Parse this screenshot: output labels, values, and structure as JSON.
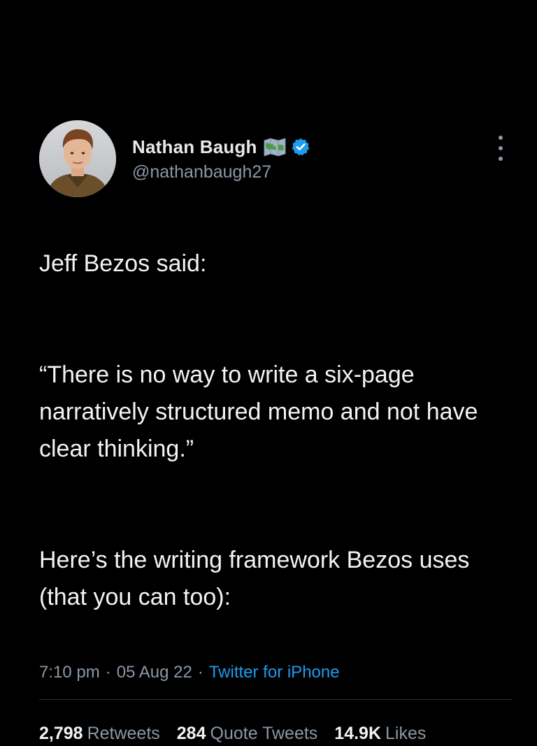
{
  "author": {
    "display_name": "Nathan Baugh",
    "handle": "@nathanbaugh27",
    "avatar": "avatar-photo",
    "badges": [
      "world-map-emoji",
      "verified-badge-icon"
    ]
  },
  "tweet": {
    "paragraphs": [
      "Jeff Bezos said:",
      "“There is no way to write a six-page narratively structured memo and not have clear thinking.”",
      "Here’s the writing framework Bezos uses (that you can too):"
    ],
    "time": "7:10 pm",
    "date": "05 Aug 22",
    "separator": "·",
    "source": "Twitter for iPhone"
  },
  "stats": {
    "retweets": {
      "count": "2,798",
      "label": "Retweets"
    },
    "quote_tweets": {
      "count": "284",
      "label": "Quote Tweets"
    },
    "likes": {
      "count": "14.9K",
      "label": "Likes"
    }
  },
  "colors": {
    "background": "#000000",
    "text_primary": "#e7e9ea",
    "text_secondary": "#8b98a5",
    "accent": "#1d9bf0",
    "divider": "#2f3336"
  },
  "icons": {
    "more": "more-vertical-icon",
    "verified": "verified-badge-icon",
    "map": "world-map-icon"
  }
}
